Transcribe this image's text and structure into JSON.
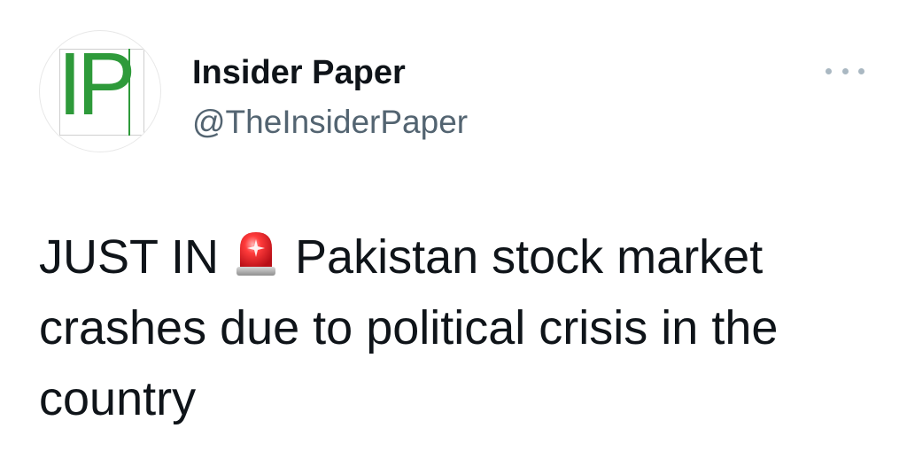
{
  "author": {
    "name": "Insider Paper",
    "handle": "@TheInsiderPaper",
    "avatar_text": "IP",
    "avatar_color": "#2e9a3a"
  },
  "menu": {
    "icon": "more-horizontal-icon"
  },
  "tweet": {
    "text_before_emoji": "JUST IN",
    "emoji": "siren-icon",
    "text_after_emoji": "Pakistan stock market crashes due to political crisis in the country"
  },
  "colors": {
    "name": "#0f1419",
    "handle": "#536471",
    "body": "#0f1419",
    "more_dots": "#aab8c2",
    "siren_red": "#e8202a"
  }
}
